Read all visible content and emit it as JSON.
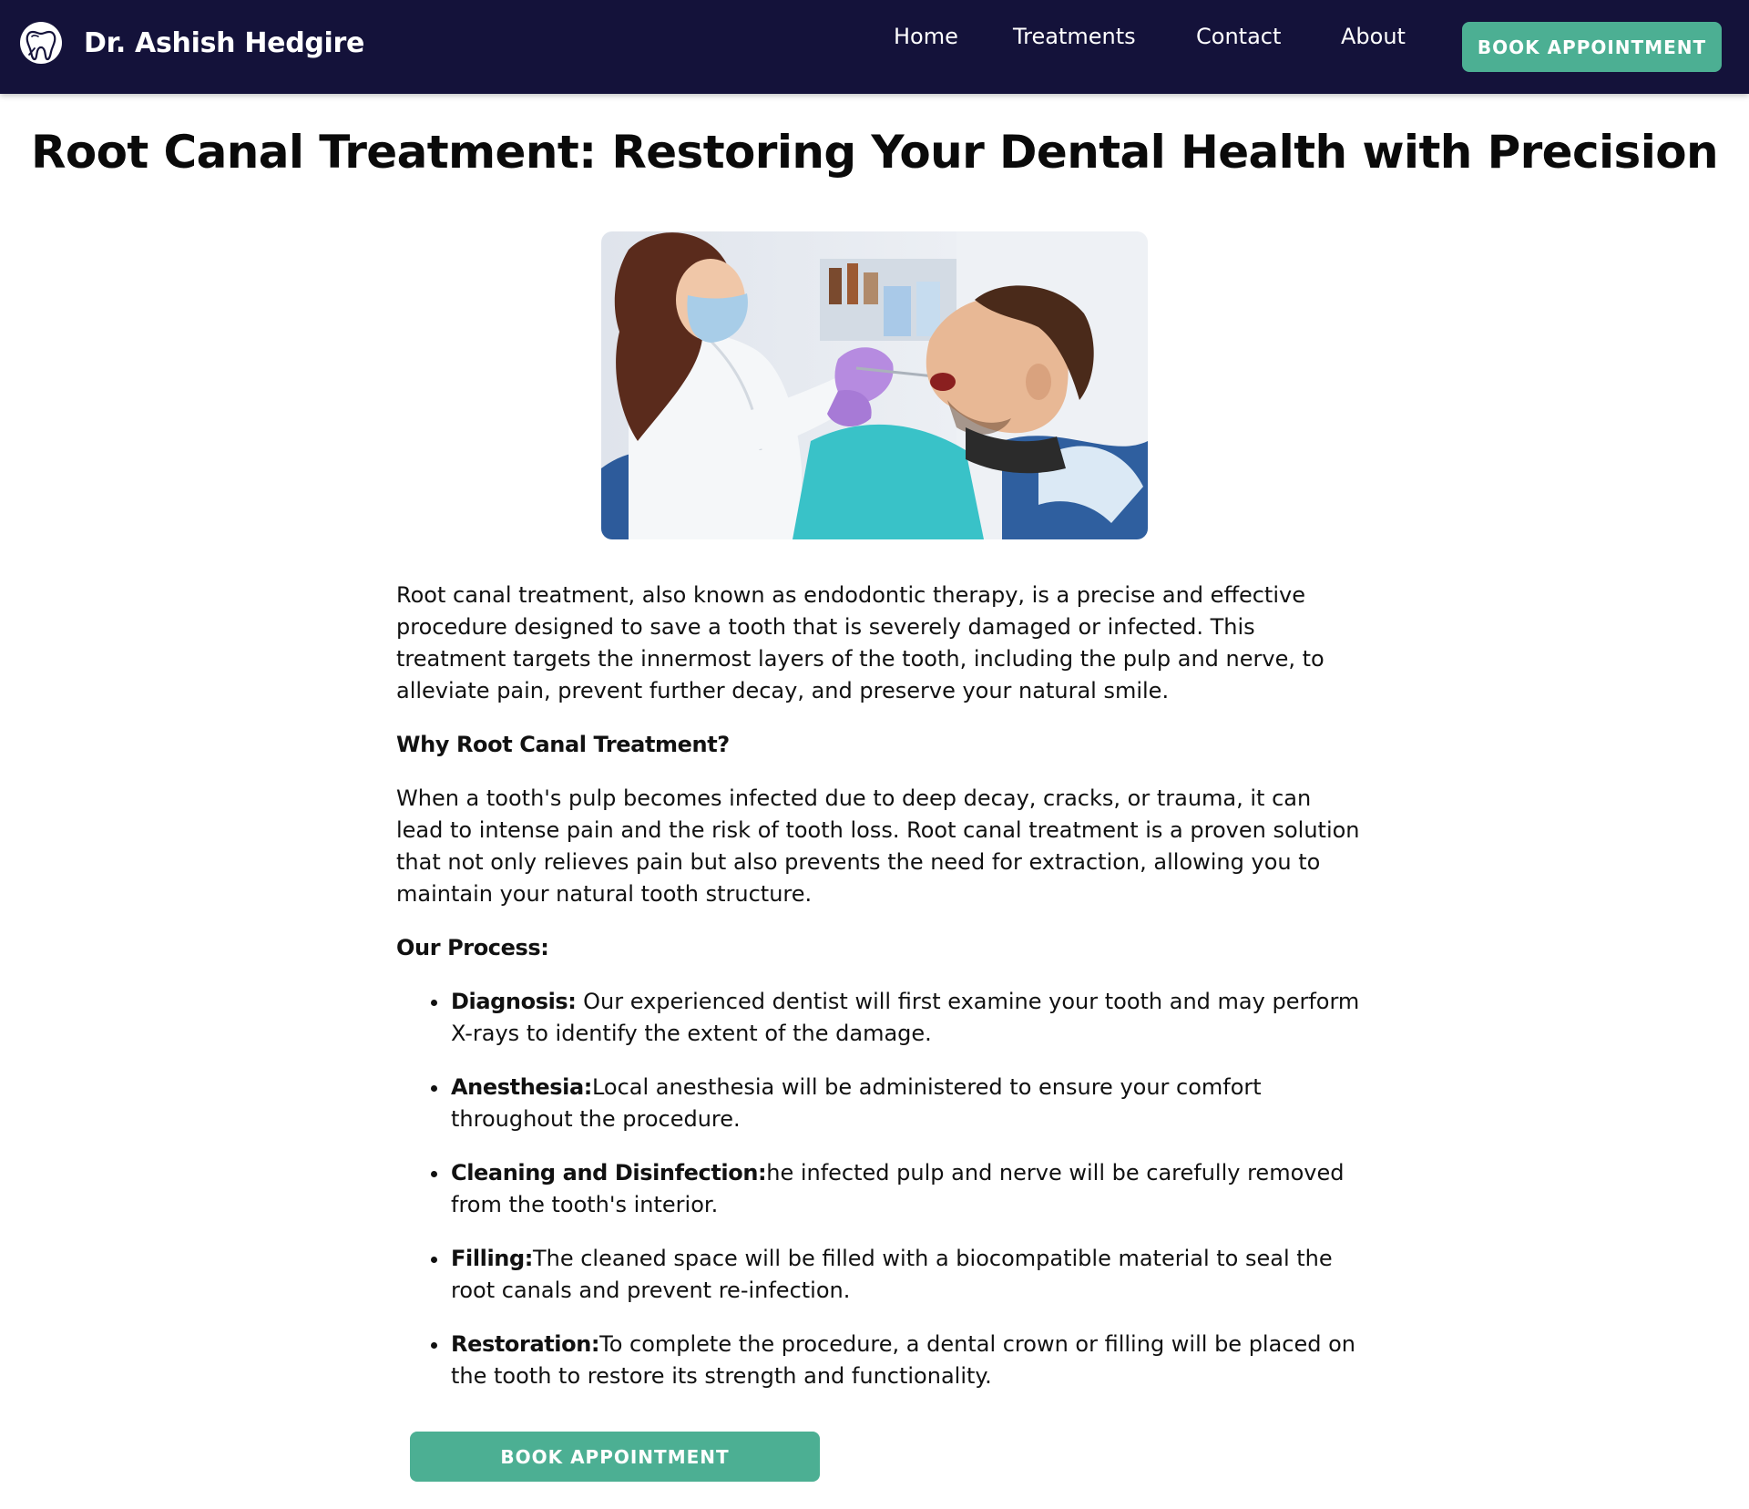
{
  "header": {
    "brand_name": "Dr. Ashish Hedgire",
    "logo_icon": "tooth-icon",
    "nav": [
      {
        "label": "Home"
      },
      {
        "label": "Treatments"
      },
      {
        "label": "Contact"
      },
      {
        "label": "About"
      }
    ],
    "cta_label": "BOOK APPOINTMENT"
  },
  "main": {
    "title": "Root Canal Treatment: Restoring Your Dental Health with Precision",
    "intro": "Root canal treatment, also known as endodontic therapy, is a precise and effective procedure designed to save a tooth that is severely damaged or infected. This treatment targets the innermost layers of the tooth, including the pulp and nerve, to alleviate pain, prevent further decay, and preserve your natural smile.",
    "why_heading": "Why Root Canal Treatment?",
    "why_text": "When a tooth's pulp becomes infected due to deep decay, cracks, or trauma, it can lead to intense pain and the risk of tooth loss. Root canal treatment is a proven solution that not only relieves pain but also prevents the need for extraction, allowing you to maintain your natural tooth structure.",
    "process_heading": "Our Process:",
    "steps": [
      {
        "title": "Diagnosis:",
        "text": " Our experienced dentist will first examine your tooth and may perform X-rays to identify the extent of the damage."
      },
      {
        "title": "Anesthesia:",
        "text": "Local anesthesia will be administered to ensure your comfort throughout the procedure."
      },
      {
        "title": "Cleaning and Disinfection:",
        "text": "he infected pulp and nerve will be carefully removed from the tooth's interior."
      },
      {
        "title": "Filling:",
        "text": "The cleaned space will be filled with a biocompatible material to seal the root canals and prevent re-infection."
      },
      {
        "title": "Restoration:",
        "text": "To complete the procedure, a dental crown or filling will be placed on the tooth to restore its strength and functionality."
      }
    ],
    "cta_label": "BOOK APPOINTMENT"
  },
  "colors": {
    "navbar_bg": "#14123a",
    "accent": "#4caf93",
    "text": "#111111"
  }
}
